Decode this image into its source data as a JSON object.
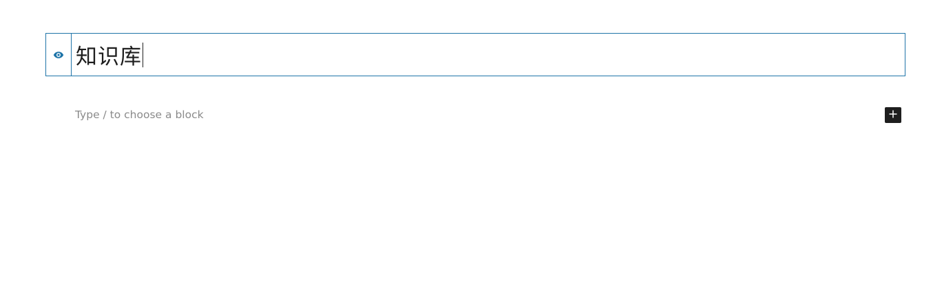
{
  "post_title": {
    "value": "知识库"
  },
  "block_editor": {
    "placeholder": "Type / to choose a block",
    "inserter_icon": "plus-icon"
  },
  "visibility": {
    "icon": "eye-icon"
  },
  "colors": {
    "accent": "#1e74a8",
    "text": "#1e1e1e",
    "placeholder": "#8a8a8a",
    "inserter_bg": "#1e1e1e"
  }
}
